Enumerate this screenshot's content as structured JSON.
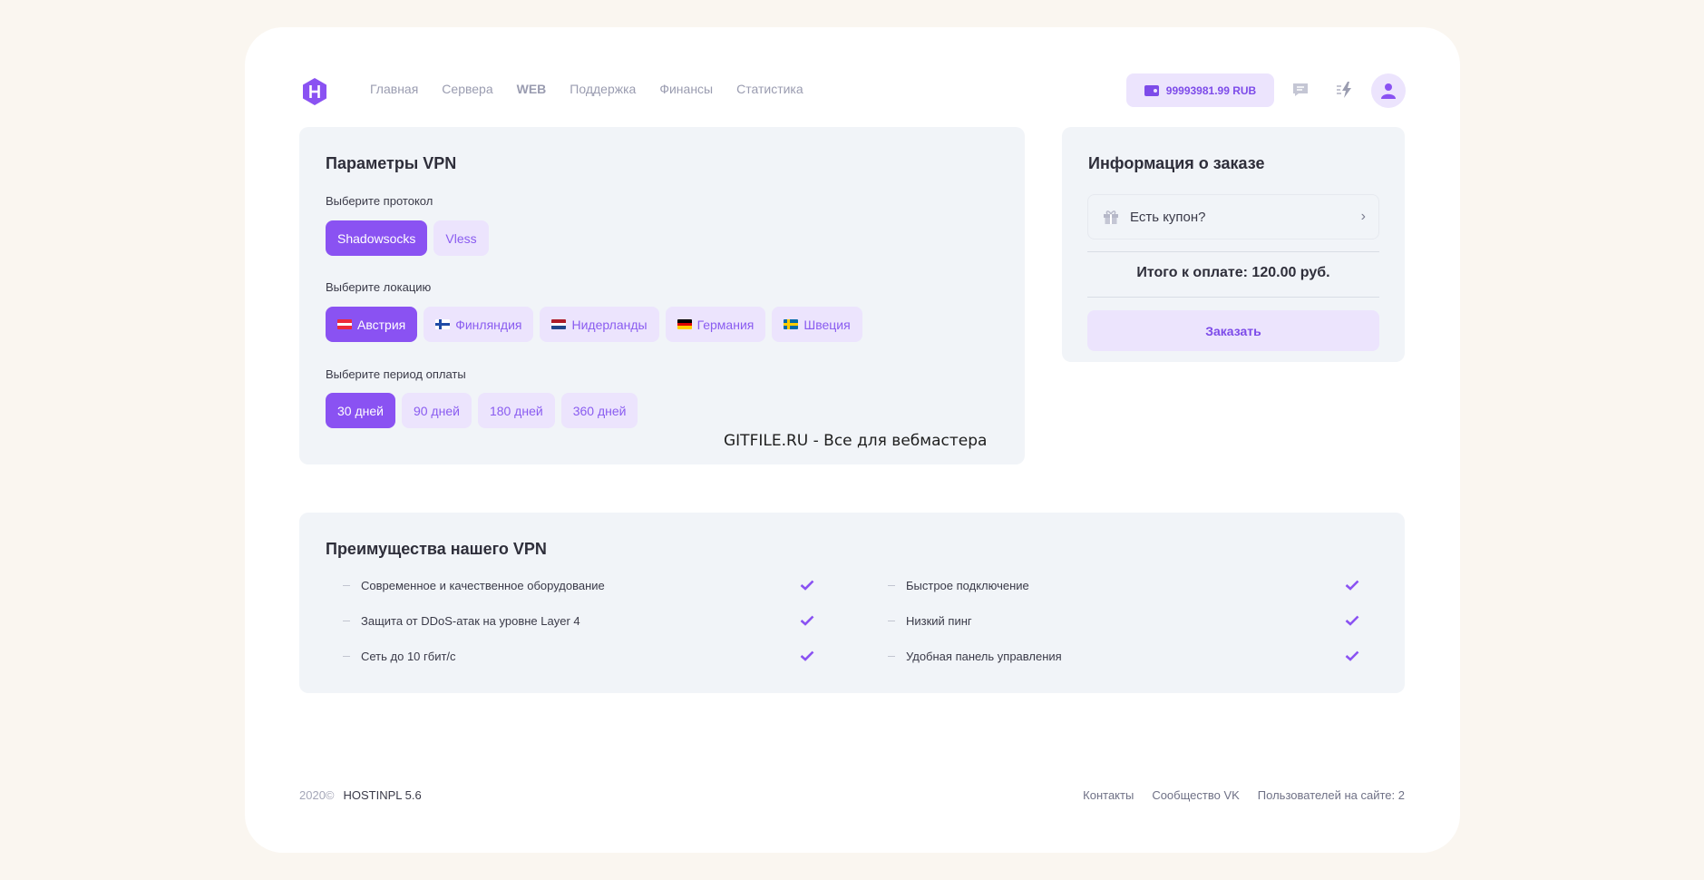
{
  "header": {
    "nav": [
      "Главная",
      "Сервера",
      "WEB",
      "Поддержка",
      "Финансы",
      "Статистика"
    ],
    "balance": "99993981.99 RUB",
    "icons": [
      "chat-icon",
      "lightning-icon",
      "user-icon"
    ]
  },
  "vpn": {
    "title": "Параметры VPN",
    "protocol_label": "Выберите протокол",
    "protocols": [
      {
        "label": "Shadowsocks",
        "active": true
      },
      {
        "label": "Vless",
        "active": false
      }
    ],
    "location_label": "Выберите локацию",
    "locations": [
      {
        "label": "Австрия",
        "flag": "at",
        "active": true
      },
      {
        "label": "Финляндия",
        "flag": "fi",
        "active": false
      },
      {
        "label": "Нидерланды",
        "flag": "nl",
        "active": false
      },
      {
        "label": "Германия",
        "flag": "de",
        "active": false
      },
      {
        "label": "Швеция",
        "flag": "se",
        "active": false
      }
    ],
    "period_label": "Выберите период оплаты",
    "periods": [
      {
        "label": "30 дней",
        "active": true
      },
      {
        "label": "90 дней",
        "active": false
      },
      {
        "label": "180 дней",
        "active": false
      },
      {
        "label": "360 дней",
        "active": false
      }
    ],
    "watermark": "GITFILE.RU - Все для вебмастера"
  },
  "order": {
    "title": "Информация о заказе",
    "coupon": "Есть купон?",
    "total": "Итого к оплате: 120.00 руб.",
    "button": "Заказать"
  },
  "advantages": {
    "title": "Преимущества нашего VPN",
    "left": [
      "Современное и качественное оборудование",
      "Защита от DDoS-атак на уровне Layer 4",
      "Сеть до 10 гбит/с"
    ],
    "right": [
      "Быстрое подключение",
      "Низкий пинг",
      "Удобная панель управления"
    ]
  },
  "footer": {
    "year": "2020©",
    "version": "HOSTINPL 5.6",
    "links": [
      "Контакты",
      "Сообщество VK",
      "Пользователей на сайте: 2"
    ]
  },
  "colors": {
    "accent": "#8a52f2",
    "accent_light": "#ece4fd",
    "panel": "#f1f4f8",
    "background": "#faf6f0"
  }
}
